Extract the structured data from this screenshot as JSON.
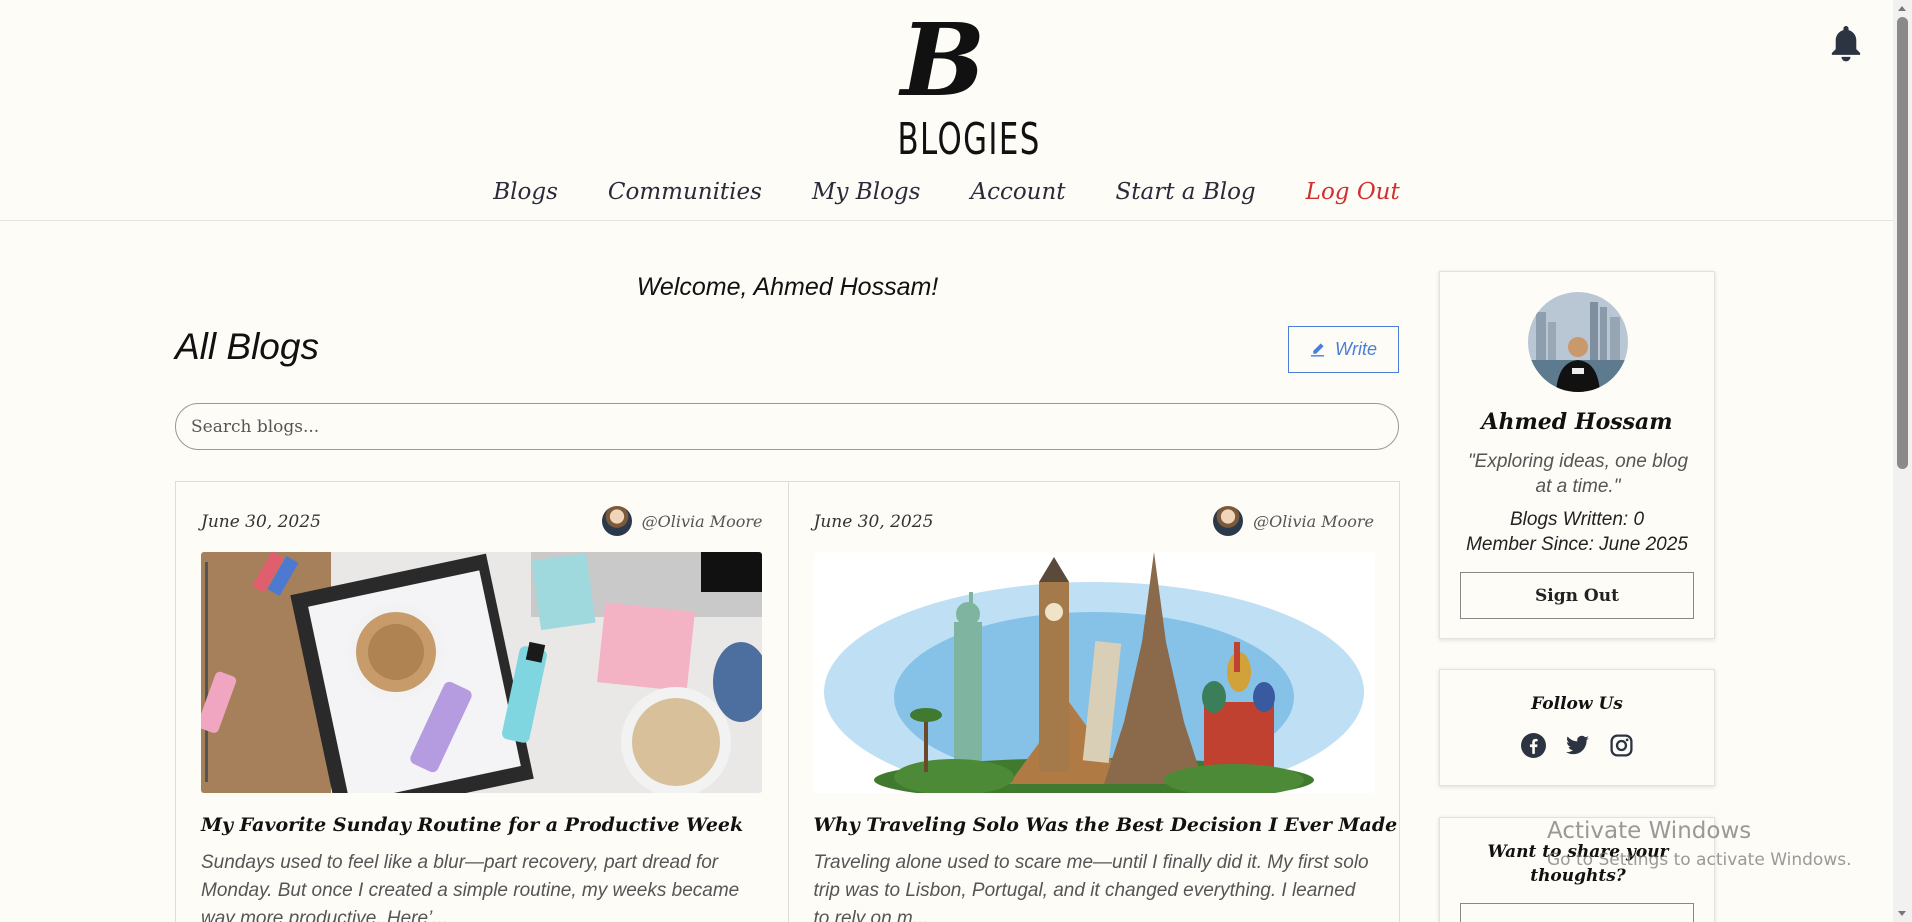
{
  "header": {
    "logo_mark": "B",
    "logo_text": "BLOGIES",
    "nav": [
      "Blogs",
      "Communities",
      "My Blogs",
      "Account",
      "Start a Blog",
      "Log Out"
    ]
  },
  "main": {
    "welcome": "Welcome, Ahmed Hossam!",
    "heading": "All Blogs",
    "write_label": "Write",
    "search_placeholder": "Search blogs..."
  },
  "blogs": [
    {
      "date": "June 30, 2025",
      "author": "@Olivia Moore",
      "title": "My Favorite Sunday Routine for a Productive Week",
      "excerpt": "Sundays used to feel like a blur—part recovery, part dread for Monday. But once I created a simple routine, my weeks became way more productive. Here’..."
    },
    {
      "date": "June 30, 2025",
      "author": "@Olivia Moore",
      "title": "Why Traveling Solo Was the Best Decision I Ever Made",
      "excerpt": "Traveling alone used to scare me—until I finally did it. My first solo trip was to Lisbon, Portugal, and it changed everything. I learned to rely on m..."
    }
  ],
  "sidebar": {
    "profile": {
      "name": "Ahmed Hossam",
      "quote": "\"Exploring ideas, one blog at a time.\"",
      "blogs_written": "Blogs Written: 0",
      "member_since": "Member Since: June 2025",
      "signout_label": "Sign Out"
    },
    "follow_title": "Follow Us",
    "share_title": "Want to share your thoughts?"
  },
  "watermark": {
    "line1": "Activate Windows",
    "line2": "Go to Settings to activate Windows."
  },
  "colors": {
    "background": "#fdfcf7",
    "accent": "#4a7fd6",
    "logout": "#d0302f"
  }
}
